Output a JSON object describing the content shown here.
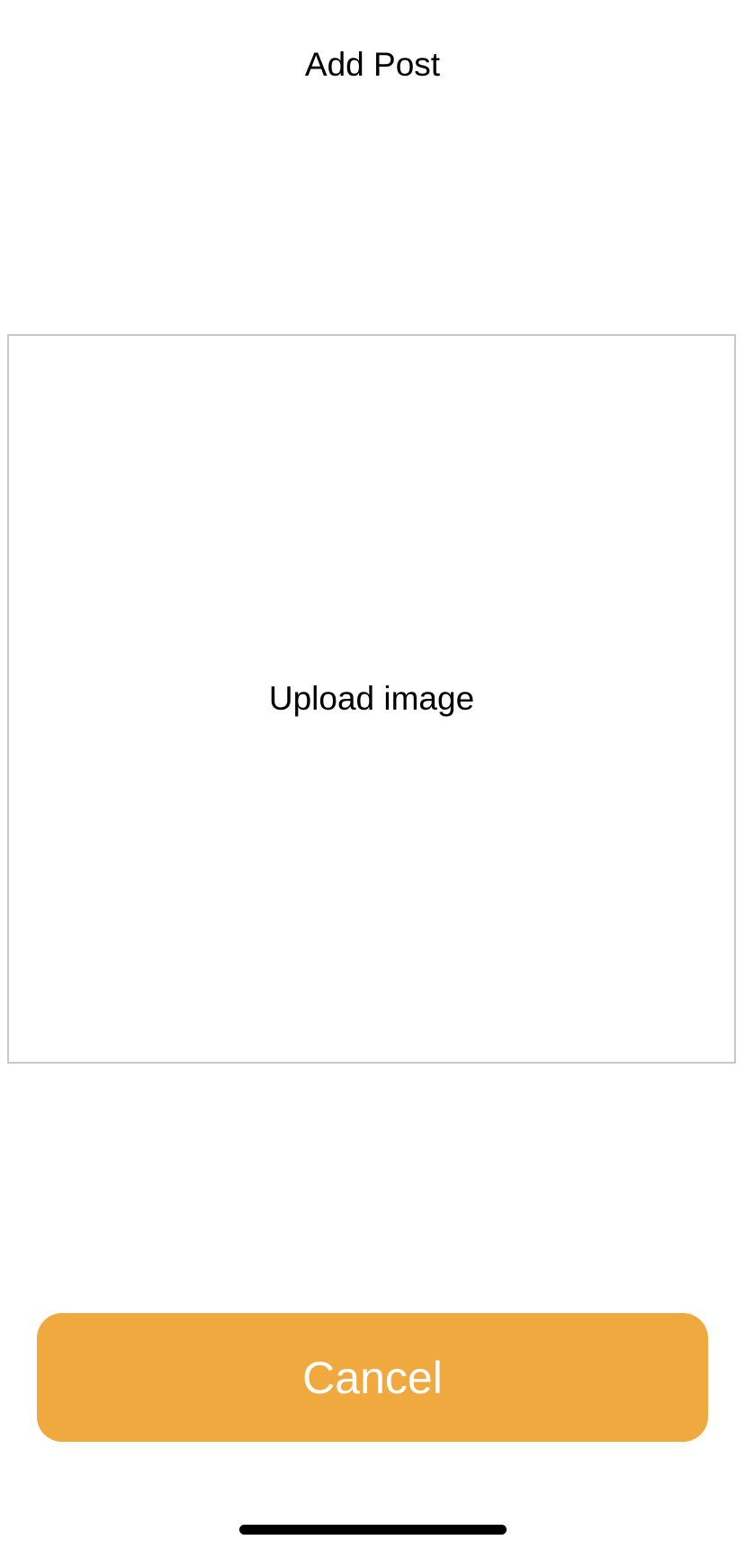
{
  "header": {
    "title": "Add Post"
  },
  "upload": {
    "label": "Upload image",
    "border_color": "#c8c8c8"
  },
  "actions": {
    "cancel_label": "Cancel",
    "cancel_color": "#f0a93e"
  },
  "colors": {
    "background": "#ffffff",
    "text": "#000000",
    "home_indicator": "#000000"
  }
}
